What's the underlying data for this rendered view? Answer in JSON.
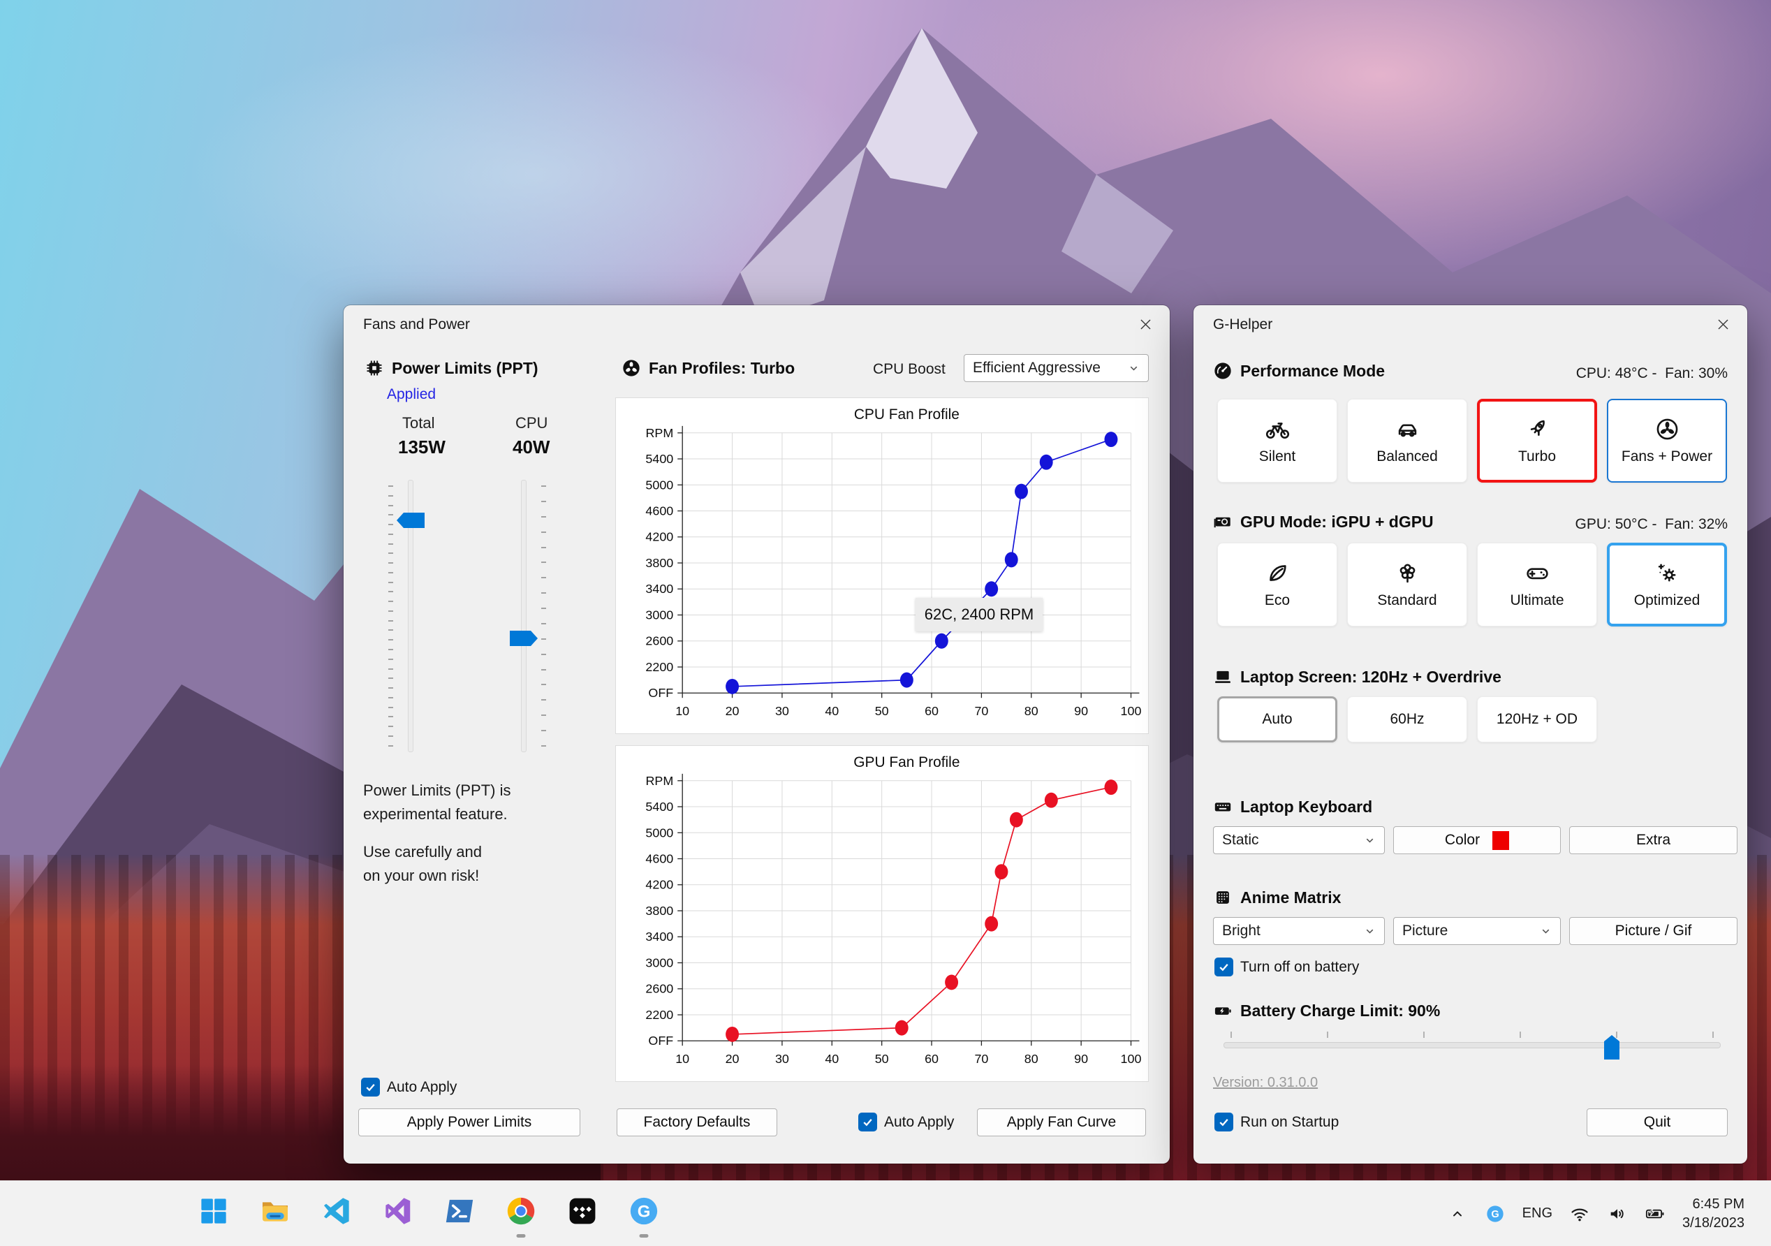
{
  "colors": {
    "accent_blue": "#0067c0",
    "slider_blue": "#0078d7",
    "turbo_selected_border": "#f21414",
    "optimized_selected_border": "#35a2ee",
    "fans_power_border": "#1976d2",
    "keyboard_color_swatch": "#ee0000",
    "cpu_curve": "#1414d8",
    "gpu_curve": "#e81123"
  },
  "fans_window": {
    "title": "Fans and Power",
    "power_limits": {
      "heading": "Power Limits (PPT)",
      "status": "Applied",
      "total_label": "Total",
      "total_value": "135W",
      "cpu_label": "CPU",
      "cpu_value": "40W",
      "total_slider_fraction": 0.127,
      "cpu_slider_fraction": 0.588,
      "note1": "Power Limits (PPT) is\nexperimental feature.",
      "note2": "Use carefully and\non your own risk!",
      "auto_apply_label": "Auto Apply",
      "auto_apply_checked": true,
      "apply_button": "Apply Power Limits"
    },
    "fan_profiles": {
      "heading": "Fan Profiles: Turbo",
      "cpu_boost_label": "CPU Boost",
      "cpu_boost_value": "Efficient Aggressive",
      "factory_defaults_button": "Factory Defaults",
      "auto_apply_label": "Auto Apply",
      "auto_apply_checked": true,
      "apply_button": "Apply Fan Curve"
    }
  },
  "chart_data": [
    {
      "type": "line",
      "title": "CPU Fan Profile",
      "color": "#1414d8",
      "series": [
        {
          "name": "CPU fan curve",
          "x": [
            20,
            55,
            62,
            72,
            76,
            78,
            83,
            96
          ],
          "y": [
            1900,
            2000,
            2600,
            3400,
            3850,
            4900,
            5350,
            5700
          ]
        }
      ],
      "x_ticks": [
        10,
        20,
        30,
        40,
        50,
        60,
        70,
        80,
        90,
        100
      ],
      "y_tick_values": [
        1800,
        2200,
        2600,
        3000,
        3400,
        3800,
        4200,
        4600,
        5000,
        5400,
        5800
      ],
      "y_tick_labels": [
        "OFF",
        "2200",
        "2600",
        "3000",
        "3400",
        "3800",
        "4200",
        "4600",
        "5000",
        "5400",
        "RPM"
      ],
      "xlim": [
        10,
        100
      ],
      "ylim": [
        1800,
        5800
      ],
      "grid": true,
      "annotation": {
        "text": "62C, 2400 RPM"
      }
    },
    {
      "type": "line",
      "title": "GPU Fan Profile",
      "color": "#e81123",
      "series": [
        {
          "name": "GPU fan curve",
          "x": [
            20,
            54,
            64,
            72,
            74,
            77,
            84,
            96
          ],
          "y": [
            1900,
            2000,
            2700,
            3600,
            4400,
            5200,
            5500,
            5700
          ]
        }
      ],
      "x_ticks": [
        10,
        20,
        30,
        40,
        50,
        60,
        70,
        80,
        90,
        100
      ],
      "y_tick_values": [
        1800,
        2200,
        2600,
        3000,
        3400,
        3800,
        4200,
        4600,
        5000,
        5400,
        5800
      ],
      "y_tick_labels": [
        "OFF",
        "2200",
        "2600",
        "3000",
        "3400",
        "3800",
        "4200",
        "4600",
        "5000",
        "5400",
        "RPM"
      ],
      "xlim": [
        10,
        100
      ],
      "ylim": [
        1800,
        5800
      ],
      "grid": true
    }
  ],
  "ghelper_window": {
    "title": "G-Helper",
    "performance": {
      "heading": "Performance Mode",
      "status": "CPU: 48°C -  Fan: 30%",
      "buttons": [
        {
          "label": "Silent",
          "icon": "bicycle-icon"
        },
        {
          "label": "Balanced",
          "icon": "car-icon"
        },
        {
          "label": "Turbo",
          "icon": "rocket-icon",
          "highlight": "red"
        },
        {
          "label": "Fans + Power",
          "icon": "fan-icon",
          "highlight": "blue-thin"
        }
      ]
    },
    "gpu": {
      "heading": "GPU Mode: iGPU + dGPU",
      "status": "GPU: 50°C -  Fan: 32%",
      "buttons": [
        {
          "label": "Eco",
          "icon": "leaf-icon"
        },
        {
          "label": "Standard",
          "icon": "flower-icon"
        },
        {
          "label": "Ultimate",
          "icon": "gamepad-icon"
        },
        {
          "label": "Optimized",
          "icon": "optimized-icon",
          "highlight": "blue"
        }
      ]
    },
    "screen": {
      "heading": "Laptop Screen: 120Hz + Overdrive",
      "buttons": [
        {
          "label": "Auto",
          "highlight": "gray"
        },
        {
          "label": "60Hz"
        },
        {
          "label": "120Hz + OD"
        }
      ]
    },
    "keyboard": {
      "heading": "Laptop Keyboard",
      "mode_value": "Static",
      "color_label": "Color",
      "color_swatch": "#ee0000",
      "extra_label": "Extra"
    },
    "anime": {
      "heading": "Anime Matrix",
      "brightness_value": "Bright",
      "mode_value": "Picture",
      "button_label": "Picture / Gif",
      "checkbox_label": "Turn off on battery",
      "checkbox_checked": true
    },
    "battery": {
      "heading": "Battery Charge Limit: 90%",
      "value_percent": 90,
      "slider_fraction": 0.79
    },
    "version_link": "Version: 0.31.0.0",
    "startup_label": "Run on Startup",
    "startup_checked": true,
    "quit_label": "Quit"
  },
  "taskbar": {
    "icons": [
      {
        "name": "start"
      },
      {
        "name": "file-explorer"
      },
      {
        "name": "vscode"
      },
      {
        "name": "visual-studio"
      },
      {
        "name": "powershell"
      },
      {
        "name": "chrome",
        "running": true
      },
      {
        "name": "tidal"
      },
      {
        "name": "ghelper",
        "running": true
      }
    ],
    "tray": {
      "language": "ENG",
      "time": "6:45 PM",
      "date": "3/18/2023"
    }
  }
}
